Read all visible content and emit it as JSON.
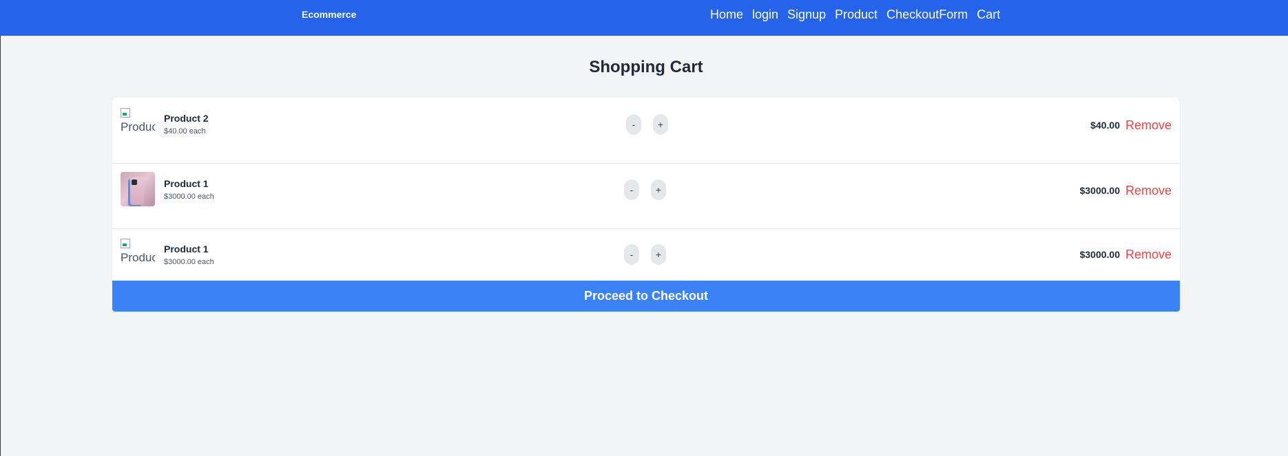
{
  "navbar": {
    "brand": "Ecommerce",
    "links": [
      "Home",
      "login",
      "Signup",
      "Product",
      "CheckoutForm",
      "Cart"
    ],
    "background": "#2563eb"
  },
  "page": {
    "title": "Shopping Cart"
  },
  "cart": {
    "items": [
      {
        "image_alt": "Produc",
        "image_state": "broken",
        "name": "Product 2",
        "each": "$40.00 each",
        "decrement": "-",
        "increment": "+",
        "total": "$40.00",
        "remove": "Remove"
      },
      {
        "image_alt": "",
        "image_state": "loaded",
        "name": "Product 1",
        "each": "$3000.00 each",
        "decrement": "-",
        "increment": "+",
        "total": "$3000.00",
        "remove": "Remove"
      },
      {
        "image_alt": "Produc",
        "image_state": "broken",
        "name": "Product 1",
        "each": "$3000.00 each",
        "decrement": "-",
        "increment": "+",
        "total": "$3000.00",
        "remove": "Remove"
      }
    ],
    "checkout_label": "Proceed to Checkout",
    "remove_color": "#ef4444",
    "checkout_color": "#3b82f6"
  }
}
